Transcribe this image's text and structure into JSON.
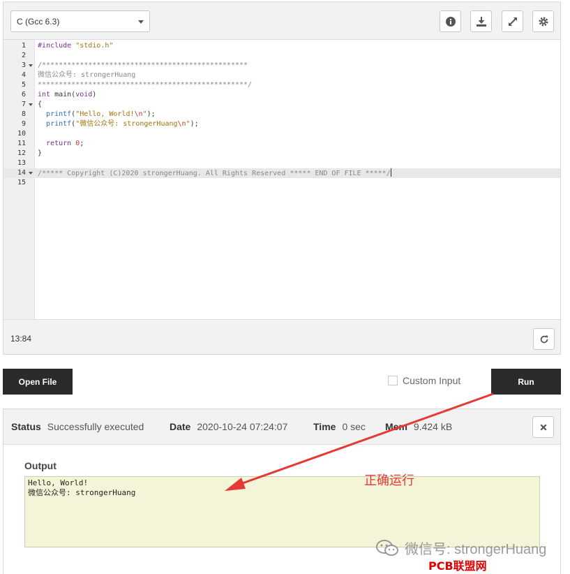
{
  "toolbar": {
    "language": "C (Gcc 6.3)",
    "icons": [
      "info-icon",
      "download-icon",
      "fullscreen-icon",
      "gear-icon"
    ]
  },
  "editor": {
    "lines": [
      {
        "n": "1",
        "text": "#include \"stdio.h\"",
        "fold": false
      },
      {
        "n": "2",
        "text": "",
        "fold": false
      },
      {
        "n": "3",
        "text": "/*************************************************",
        "fold": true
      },
      {
        "n": "4",
        "text": "微信公众号: strongerHuang",
        "fold": false
      },
      {
        "n": "5",
        "text": "**************************************************/",
        "fold": false
      },
      {
        "n": "6",
        "text": "int main(void)",
        "fold": false
      },
      {
        "n": "7",
        "text": "{",
        "fold": true
      },
      {
        "n": "8",
        "text": "  printf(\"Hello, World!\\n\");",
        "fold": false
      },
      {
        "n": "9",
        "text": "  printf(\"微信公众号: strongerHuang\\n\");",
        "fold": false
      },
      {
        "n": "10",
        "text": "",
        "fold": false
      },
      {
        "n": "11",
        "text": "  return 0;",
        "fold": false
      },
      {
        "n": "12",
        "text": "}",
        "fold": false
      },
      {
        "n": "13",
        "text": "",
        "fold": false
      },
      {
        "n": "14",
        "text": "/***** Copyright (C)2020 strongerHuang. All Rights Reserved ***** END OF FILE *****/",
        "fold": true
      },
      {
        "n": "15",
        "text": "",
        "fold": false
      }
    ],
    "active_line": "14",
    "cursor_position": "13:84"
  },
  "actions": {
    "open_file": "Open File",
    "custom_input": "Custom Input",
    "run": "Run"
  },
  "result": {
    "status_label": "Status",
    "status_value": "Successfully executed",
    "date_label": "Date",
    "date_value": "2020-10-24 07:24:07",
    "time_label": "Time",
    "time_value": "0 sec",
    "mem_label": "Mem",
    "mem_value": "9.424 kB",
    "output_label": "Output",
    "output_text": "Hello, World!\n微信公众号: strongerHuang"
  },
  "overlay": {
    "annotation": "正确运行",
    "arrow_color": "#e53935",
    "watermark_wechat": "微信号: strongerHuang",
    "watermark_site": "PCB联盟网 (Pcbbar.com)"
  }
}
